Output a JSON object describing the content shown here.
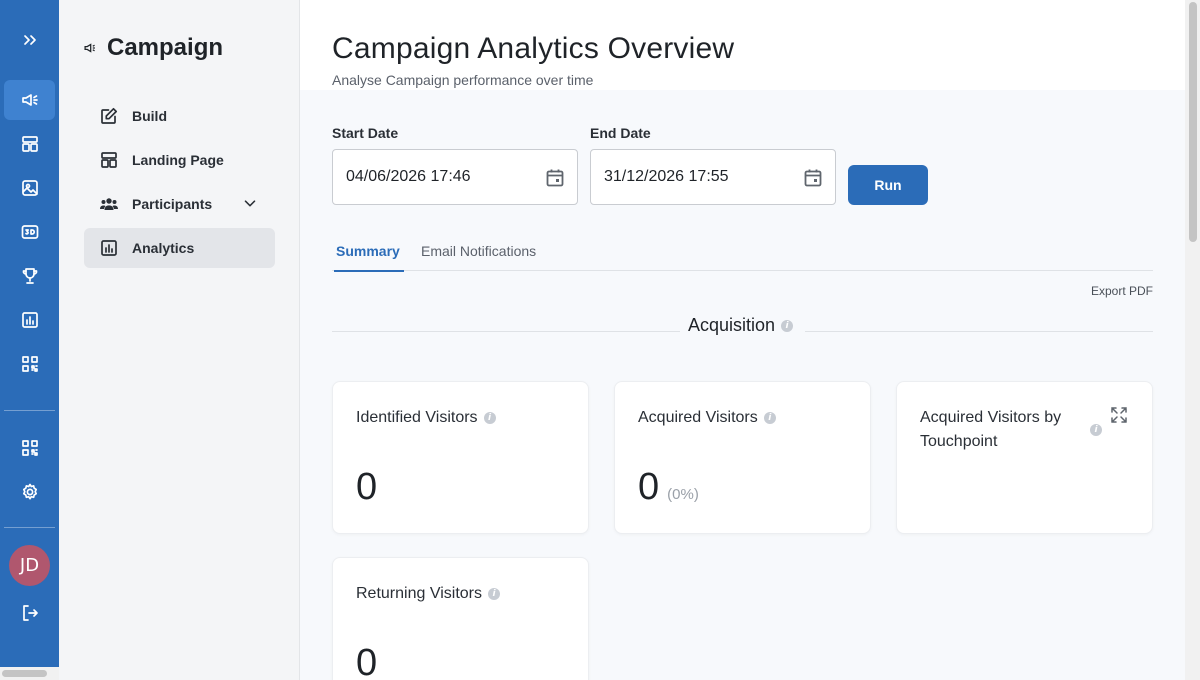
{
  "rail": {
    "avatar_initials": "JD",
    "icons": [
      "expand-icon",
      "megaphone-icon",
      "layout-icon",
      "image-icon",
      "3d-icon",
      "trophy-icon",
      "chart-icon",
      "qr-code-icon",
      "qr-code-icon",
      "gear-icon",
      "logout-icon"
    ],
    "accent": "#2b6cb8",
    "avatar_color": "#b0576e"
  },
  "sidebar": {
    "title": "Campaign",
    "items": [
      {
        "label": "Build",
        "icon": "edit-icon"
      },
      {
        "label": "Landing Page",
        "icon": "layout-icon"
      },
      {
        "label": "Participants",
        "icon": "users-icon"
      },
      {
        "label": "Analytics",
        "icon": "chart-icon",
        "active": true
      }
    ]
  },
  "header": {
    "title": "Campaign Analytics Overview",
    "subtitle": "Analyse Campaign performance over time"
  },
  "filters": {
    "start_label": "Start Date",
    "start_value": "04/06/2026 17:46",
    "end_label": "End Date",
    "end_value": "31/12/2026 17:55",
    "run_label": "Run"
  },
  "tabs": [
    {
      "label": "Summary",
      "active": true
    },
    {
      "label": "Email Notifications"
    }
  ],
  "export_label": "Export PDF",
  "section": {
    "title": "Acquisition"
  },
  "cards": {
    "identified": {
      "title": "Identified Visitors",
      "value": "0"
    },
    "acquired": {
      "title": "Acquired Visitors",
      "value": "0",
      "pct": "(0%)"
    },
    "touchpoint": {
      "title": "Acquired Visitors by Touchpoint"
    },
    "returning": {
      "title": "Returning Visitors",
      "value": "0"
    }
  }
}
